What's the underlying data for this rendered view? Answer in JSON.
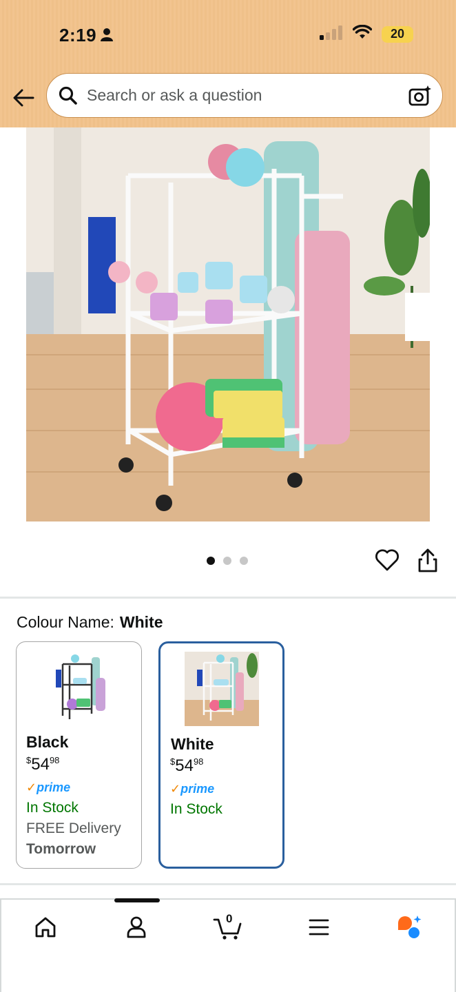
{
  "status_bar": {
    "time": "2:19",
    "battery": "20"
  },
  "search": {
    "placeholder": "Search or ask a question"
  },
  "gallery": {
    "dot_count": 3,
    "active_index": 0
  },
  "colour": {
    "label": "Colour Name:",
    "selected": "White"
  },
  "variants": [
    {
      "name": "Black",
      "price_currency": "$",
      "price_whole": "54",
      "price_fraction": "98",
      "prime": "prime",
      "stock": "In Stock",
      "delivery": "FREE Delivery",
      "delivery_day": "Tomorrow"
    },
    {
      "name": "White",
      "price_currency": "$",
      "price_whole": "54",
      "price_fraction": "98",
      "prime": "prime",
      "stock": "In Stock"
    }
  ],
  "bottom_nav": {
    "cart_count": "0"
  },
  "colors": {
    "header": "#f2c48f",
    "selected_border": "#2a5f9e",
    "in_stock": "#007600",
    "prime": "#1a98ff",
    "prime_check": "#f08804",
    "rufus_orange": "#ff6a1a",
    "rufus_blue": "#1a8cff"
  },
  "icons": [
    "back-arrow-icon",
    "search-icon",
    "camera-icon",
    "heart-icon",
    "share-icon",
    "home-icon",
    "account-icon",
    "cart-icon",
    "menu-icon",
    "rufus-icon"
  ]
}
